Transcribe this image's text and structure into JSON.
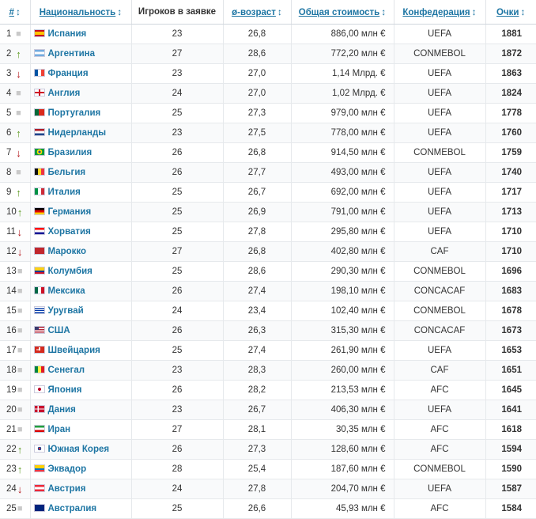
{
  "headers": {
    "rank": "#",
    "nationality": "Национальность",
    "players": "Игроков в заявке",
    "age": "ø-возраст",
    "value": "Общая стоимость",
    "confed": "Конфедерация",
    "points": "Очки",
    "sort_glyph": "↕"
  },
  "rows": [
    {
      "rank": "1",
      "trend": "same",
      "country": "Испания",
      "flag": "spain",
      "players": "23",
      "age": "26,8",
      "value": "886,00 млн €",
      "confed": "UEFA",
      "points": "1881"
    },
    {
      "rank": "2",
      "trend": "up",
      "country": "Аргентина",
      "flag": "argentina",
      "players": "27",
      "age": "28,6",
      "value": "772,20 млн €",
      "confed": "CONMEBOL",
      "points": "1872"
    },
    {
      "rank": "3",
      "trend": "down",
      "country": "Франция",
      "flag": "france",
      "players": "23",
      "age": "27,0",
      "value": "1,14 Млрд. €",
      "confed": "UEFA",
      "points": "1863"
    },
    {
      "rank": "4",
      "trend": "same",
      "country": "Англия",
      "flag": "england",
      "players": "24",
      "age": "27,0",
      "value": "1,02 Млрд. €",
      "confed": "UEFA",
      "points": "1824"
    },
    {
      "rank": "5",
      "trend": "same",
      "country": "Португалия",
      "flag": "portugal",
      "players": "25",
      "age": "27,3",
      "value": "979,00 млн €",
      "confed": "UEFA",
      "points": "1778"
    },
    {
      "rank": "6",
      "trend": "up",
      "country": "Нидерланды",
      "flag": "netherlands",
      "players": "23",
      "age": "27,5",
      "value": "778,00 млн €",
      "confed": "UEFA",
      "points": "1760"
    },
    {
      "rank": "7",
      "trend": "down",
      "country": "Бразилия",
      "flag": "brazil",
      "players": "26",
      "age": "26,8",
      "value": "914,50 млн €",
      "confed": "CONMEBOL",
      "points": "1759"
    },
    {
      "rank": "8",
      "trend": "same",
      "country": "Бельгия",
      "flag": "belgium",
      "players": "26",
      "age": "27,7",
      "value": "493,00 млн €",
      "confed": "UEFA",
      "points": "1740"
    },
    {
      "rank": "9",
      "trend": "up",
      "country": "Италия",
      "flag": "italy",
      "players": "25",
      "age": "26,7",
      "value": "692,00 млн €",
      "confed": "UEFA",
      "points": "1717"
    },
    {
      "rank": "10",
      "trend": "up",
      "country": "Германия",
      "flag": "germany",
      "players": "25",
      "age": "26,9",
      "value": "791,00 млн €",
      "confed": "UEFA",
      "points": "1713"
    },
    {
      "rank": "11",
      "trend": "down",
      "country": "Хорватия",
      "flag": "croatia",
      "players": "25",
      "age": "27,8",
      "value": "295,80 млн €",
      "confed": "UEFA",
      "points": "1710"
    },
    {
      "rank": "12",
      "trend": "down",
      "country": "Марокко",
      "flag": "morocco",
      "players": "27",
      "age": "26,8",
      "value": "402,80 млн €",
      "confed": "CAF",
      "points": "1710"
    },
    {
      "rank": "13",
      "trend": "same",
      "country": "Колумбия",
      "flag": "colombia",
      "players": "25",
      "age": "28,6",
      "value": "290,30 млн €",
      "confed": "CONMEBOL",
      "points": "1696"
    },
    {
      "rank": "14",
      "trend": "same",
      "country": "Мексика",
      "flag": "mexico",
      "players": "26",
      "age": "27,4",
      "value": "198,10 млн €",
      "confed": "CONCACAF",
      "points": "1683"
    },
    {
      "rank": "15",
      "trend": "same",
      "country": "Уругвай",
      "flag": "uruguay",
      "players": "24",
      "age": "23,4",
      "value": "102,40 млн €",
      "confed": "CONMEBOL",
      "points": "1678"
    },
    {
      "rank": "16",
      "trend": "same",
      "country": "США",
      "flag": "usa",
      "players": "26",
      "age": "26,3",
      "value": "315,30 млн €",
      "confed": "CONCACAF",
      "points": "1673"
    },
    {
      "rank": "17",
      "trend": "same",
      "country": "Швейцария",
      "flag": "switzerland",
      "players": "25",
      "age": "27,4",
      "value": "261,90 млн €",
      "confed": "UEFA",
      "points": "1653"
    },
    {
      "rank": "18",
      "trend": "same",
      "country": "Сенегал",
      "flag": "senegal",
      "players": "23",
      "age": "28,3",
      "value": "260,00 млн €",
      "confed": "CAF",
      "points": "1651"
    },
    {
      "rank": "19",
      "trend": "same",
      "country": "Япония",
      "flag": "japan",
      "players": "26",
      "age": "28,2",
      "value": "213,53 млн €",
      "confed": "AFC",
      "points": "1645"
    },
    {
      "rank": "20",
      "trend": "same",
      "country": "Дания",
      "flag": "denmark",
      "players": "23",
      "age": "26,7",
      "value": "406,30 млн €",
      "confed": "UEFA",
      "points": "1641"
    },
    {
      "rank": "21",
      "trend": "same",
      "country": "Иран",
      "flag": "iran",
      "players": "27",
      "age": "28,1",
      "value": "30,35 млн €",
      "confed": "AFC",
      "points": "1618"
    },
    {
      "rank": "22",
      "trend": "up",
      "country": "Южная Корея",
      "flag": "south-korea",
      "players": "26",
      "age": "27,3",
      "value": "128,60 млн €",
      "confed": "AFC",
      "points": "1594"
    },
    {
      "rank": "23",
      "trend": "up",
      "country": "Эквадор",
      "flag": "ecuador",
      "players": "28",
      "age": "25,4",
      "value": "187,60 млн €",
      "confed": "CONMEBOL",
      "points": "1590"
    },
    {
      "rank": "24",
      "trend": "down",
      "country": "Австрия",
      "flag": "austria",
      "players": "24",
      "age": "27,8",
      "value": "204,70 млн €",
      "confed": "UEFA",
      "points": "1587"
    },
    {
      "rank": "25",
      "trend": "same",
      "country": "Австралия",
      "flag": "australia",
      "players": "25",
      "age": "26,6",
      "value": "45,93 млн €",
      "confed": "AFC",
      "points": "1584"
    }
  ],
  "colors": {
    "link": "#1d75a3",
    "trend_up": "#5c9a1f",
    "trend_down": "#b4161b",
    "trend_same": "#c9c9c9"
  }
}
